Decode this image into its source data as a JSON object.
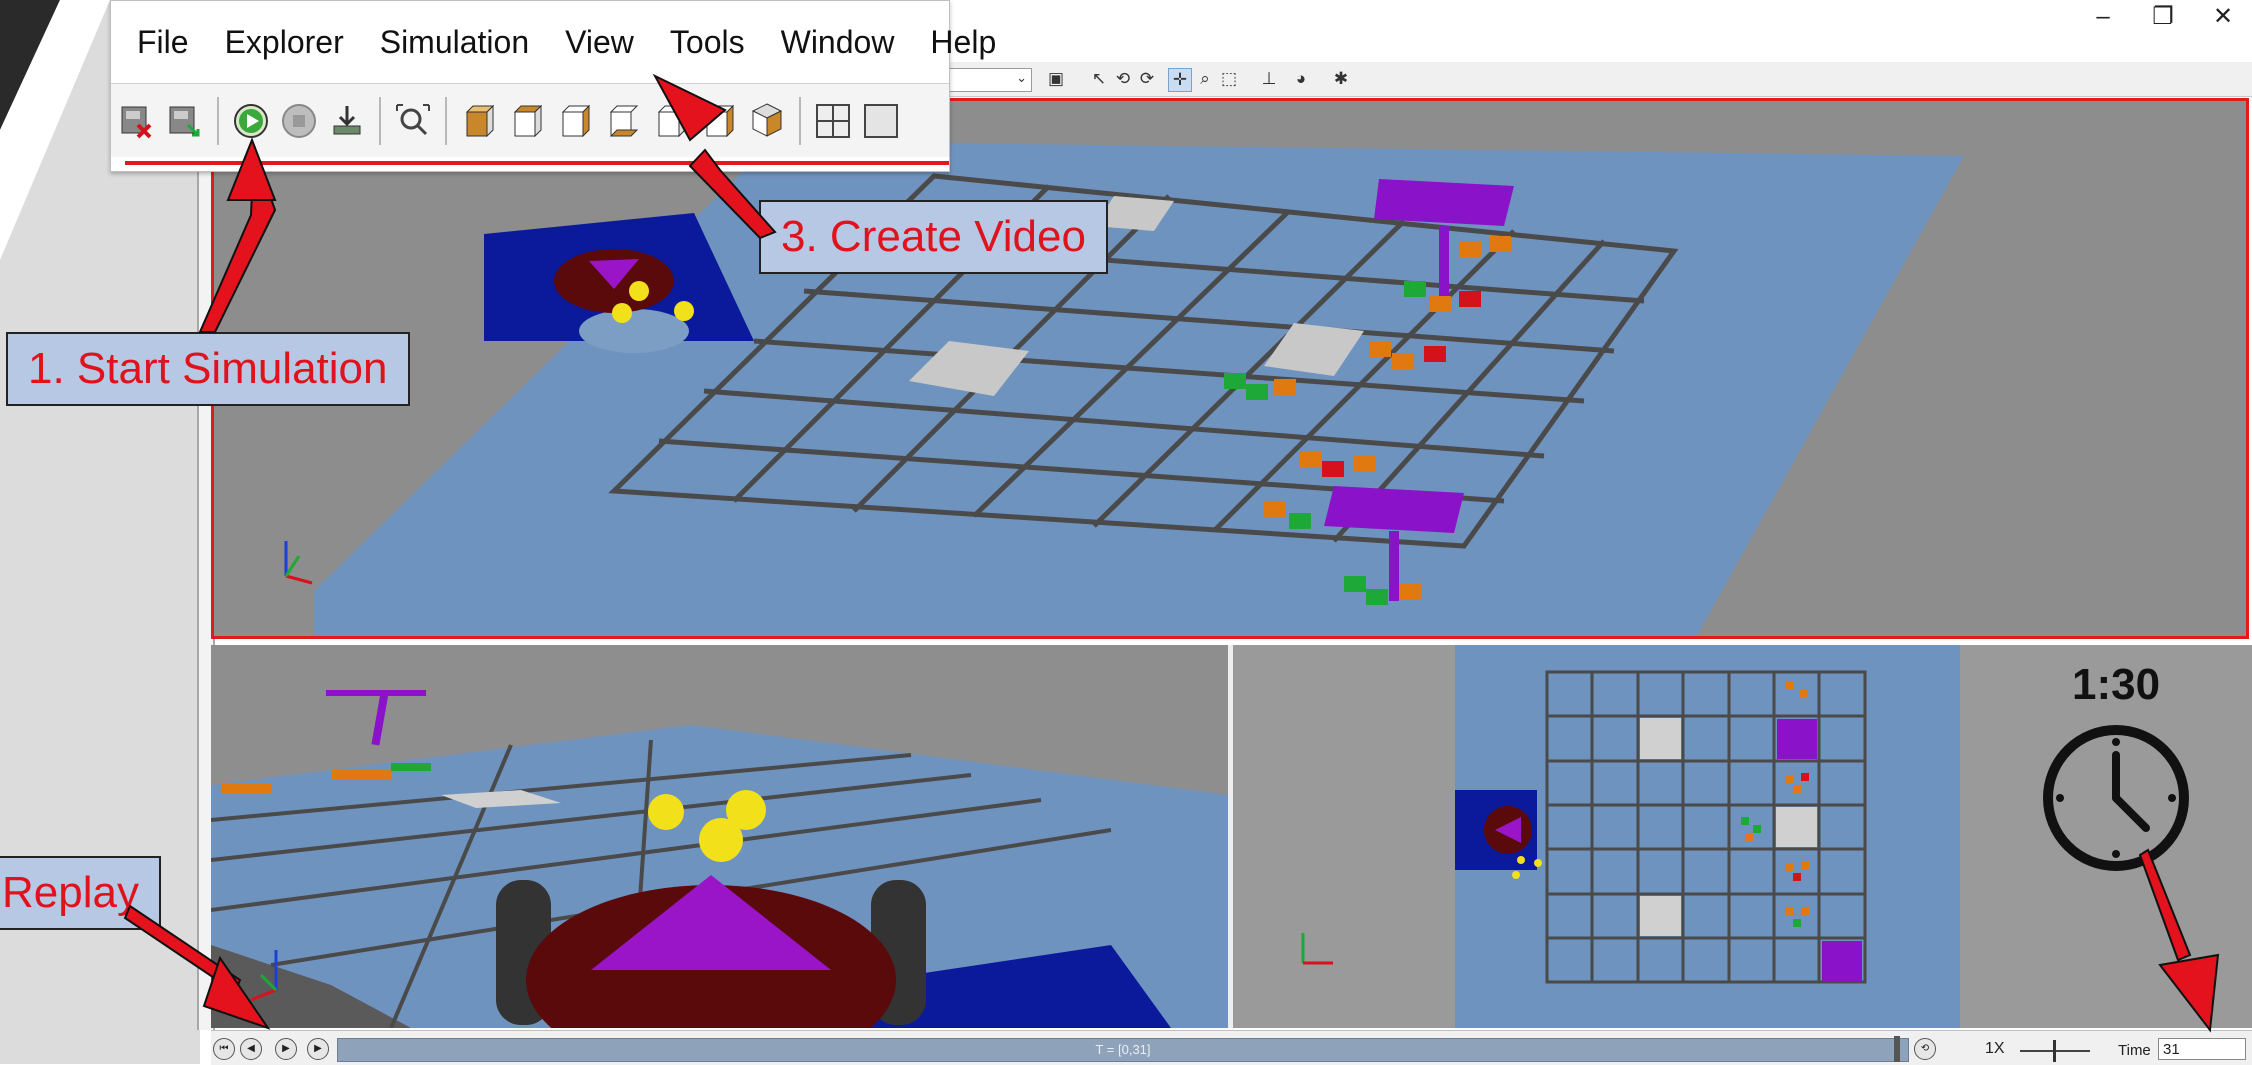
{
  "menu": {
    "items": [
      "File",
      "Explorer",
      "Simulation",
      "View",
      "Tools",
      "Window",
      "Help"
    ]
  },
  "toolbar": {
    "icons": [
      "delete-world-icon",
      "save-world-icon",
      "play-icon",
      "stop-icon",
      "download-icon",
      "zoom-fit-icon",
      "cube-view-1-icon",
      "cube-view-2-icon",
      "cube-view-3-icon",
      "cube-view-4-icon",
      "cube-view-5-icon",
      "cube-view-6-icon",
      "cube-view-7-icon",
      "quad-layout-icon",
      "single-layout-icon"
    ]
  },
  "window_controls": {
    "minimize": "–",
    "restore": "❐",
    "close": "✕"
  },
  "combo": {
    "value": ")"
  },
  "callouts": {
    "start": "1. Start Simulation",
    "video": "3. Create Video",
    "replay": "Replay"
  },
  "timer": {
    "label": "1:30"
  },
  "replay_bar": {
    "timeline_text": "T = [0,31]",
    "speed": "1X",
    "time_label": "Time",
    "time_value": "31"
  },
  "colors": {
    "callout_bg": "#b7c8e4",
    "callout_text": "#e0121c",
    "viewport_border": "#e11a1a",
    "floor": "#6f93bf",
    "grid_line": "#4a4a4a",
    "purple": "#8a12c8",
    "robot_body": "#5a0a0a",
    "arrow": "#e3121c"
  }
}
